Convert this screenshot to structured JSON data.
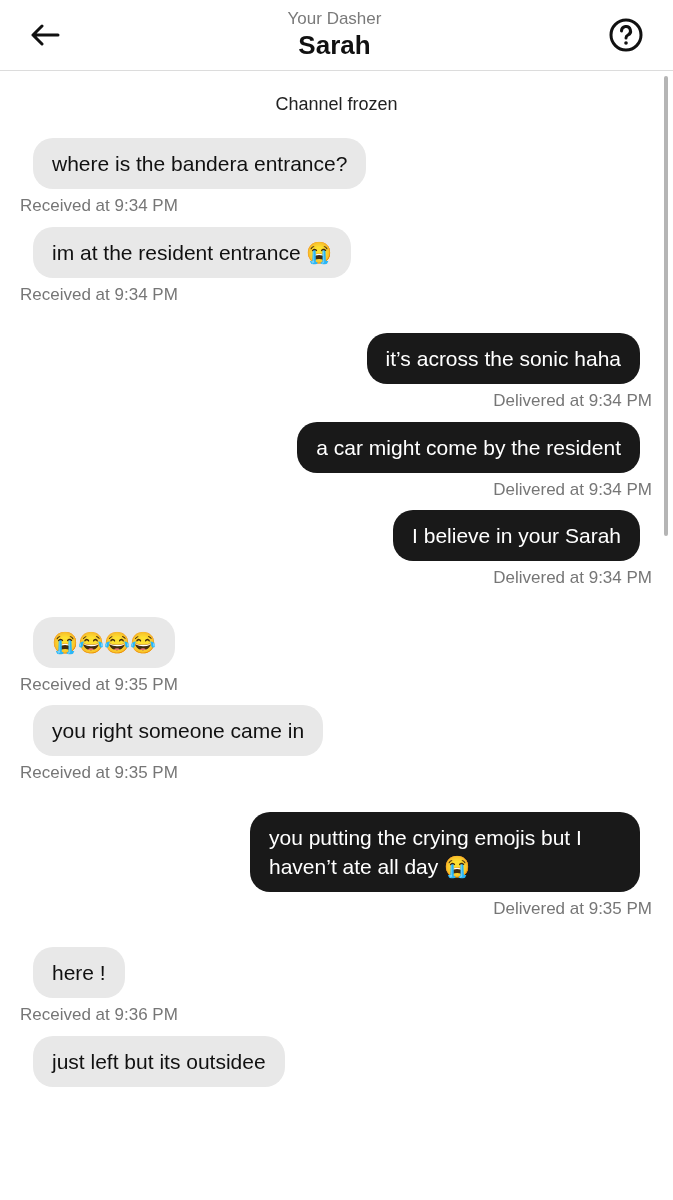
{
  "header": {
    "subtitle": "Your Dasher",
    "title": "Sarah"
  },
  "notice": "Channel frozen",
  "messages": [
    {
      "kind": "received",
      "text": "where is the bandera entrance?",
      "status": "Received at 9:34 PM"
    },
    {
      "kind": "received",
      "text": "im at the resident entrance 😭",
      "status": "Received at 9:34 PM"
    },
    {
      "kind": "sent",
      "text": "it’s across the sonic haha",
      "status": "Delivered at 9:34 PM"
    },
    {
      "kind": "sent",
      "text": "a car might come by the resident",
      "status": "Delivered at 9:34 PM"
    },
    {
      "kind": "sent",
      "text": "I believe in your Sarah",
      "status": "Delivered at 9:34 PM"
    },
    {
      "kind": "received",
      "text": "😭😂😂😂",
      "status": "Received at 9:35 PM"
    },
    {
      "kind": "received",
      "text": "you right someone came in",
      "status": "Received at 9:35 PM"
    },
    {
      "kind": "sent",
      "text": "you putting the crying emojis but I haven’t ate all day 😭",
      "status": "Delivered at 9:35 PM"
    },
    {
      "kind": "received",
      "text": "here !",
      "status": "Received at 9:36 PM"
    },
    {
      "kind": "received",
      "text": "just left but its outsidee"
    }
  ]
}
